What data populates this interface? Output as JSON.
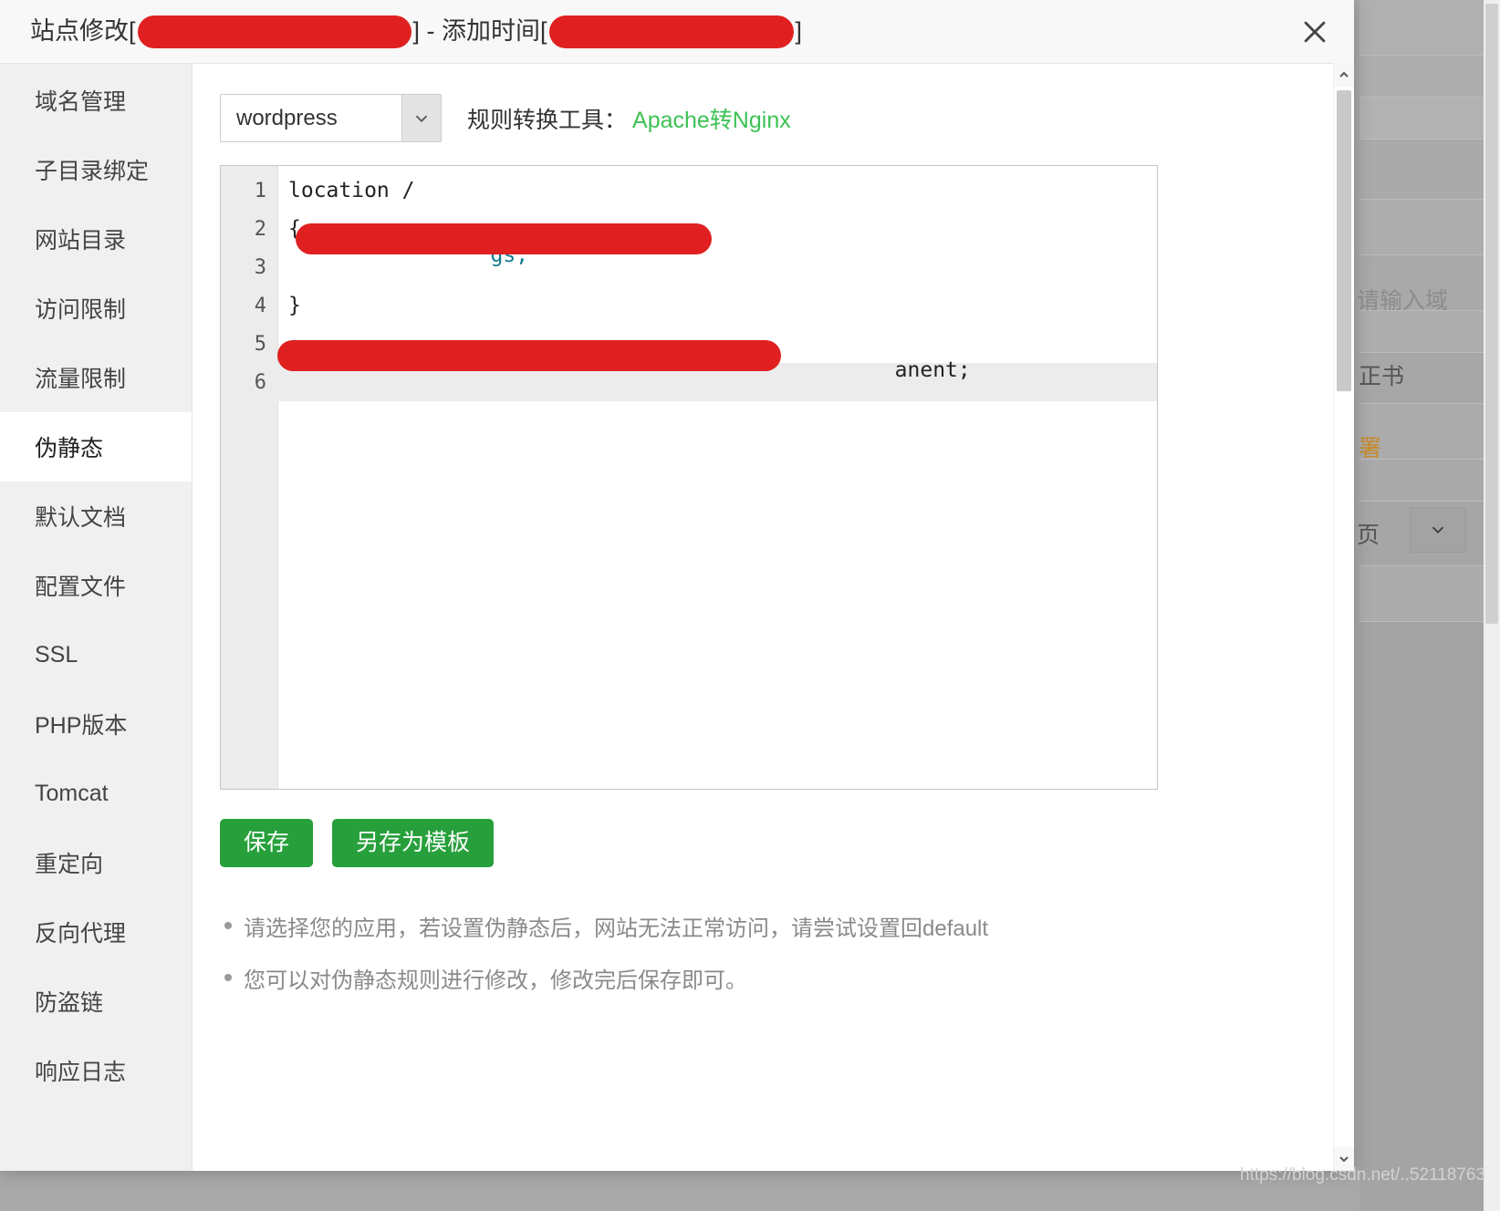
{
  "modal": {
    "title_prefix": "站点修改[",
    "title_middle": "] - 添加时间[",
    "title_suffix": "]",
    "close_icon": "close-icon"
  },
  "sidebar": {
    "items": [
      {
        "label": "域名管理",
        "active": false
      },
      {
        "label": "子目录绑定",
        "active": false
      },
      {
        "label": "网站目录",
        "active": false
      },
      {
        "label": "访问限制",
        "active": false
      },
      {
        "label": "流量限制",
        "active": false
      },
      {
        "label": "伪静态",
        "active": true
      },
      {
        "label": "默认文档",
        "active": false
      },
      {
        "label": "配置文件",
        "active": false
      },
      {
        "label": "SSL",
        "active": false
      },
      {
        "label": "PHP版本",
        "active": false
      },
      {
        "label": "Tomcat",
        "active": false
      },
      {
        "label": "重定向",
        "active": false
      },
      {
        "label": "反向代理",
        "active": false
      },
      {
        "label": "防盗链",
        "active": false
      },
      {
        "label": "响应日志",
        "active": false
      }
    ]
  },
  "toolbar": {
    "app_select_value": "wordpress",
    "app_select_icon": "chevron-down-icon",
    "convert_label": "规则转换工具：",
    "convert_link": "Apache转Nginx",
    "convert_link_color": "#3ec254"
  },
  "editor": {
    "lines": [
      {
        "no": "1",
        "code": "location /",
        "redacted": false,
        "active": false
      },
      {
        "no": "2",
        "code": "{",
        "redacted": false,
        "active": false
      },
      {
        "no": "3",
        "code": "    gs;",
        "redacted": true,
        "active": false
      },
      {
        "no": "4",
        "code": "}",
        "redacted": false,
        "active": false
      },
      {
        "no": "5",
        "code": "",
        "redacted": false,
        "active": false
      },
      {
        "no": "6",
        "code": "                                    anent;",
        "redacted": true,
        "active": true
      }
    ]
  },
  "buttons": {
    "save_label": "保存",
    "save_as_template_label": "另存为模板",
    "color": "#27a03b"
  },
  "notes": [
    "请选择您的应用，若设置伪静态后，网站无法正常访问，请尝试设置回default",
    "您可以对伪静态规则进行修改，修改完后保存即可。"
  ],
  "background": {
    "domain_placeholder": "请输入域",
    "certificate_text": "正书",
    "deploy_link": "署",
    "page_label": "页",
    "select_icon": "chevron-down-icon"
  },
  "scrollbars": {
    "up_icon": "chevron-up-icon",
    "down_icon": "chevron-down-icon"
  },
  "watermark": "https://blog.csdn.net/..52118763"
}
